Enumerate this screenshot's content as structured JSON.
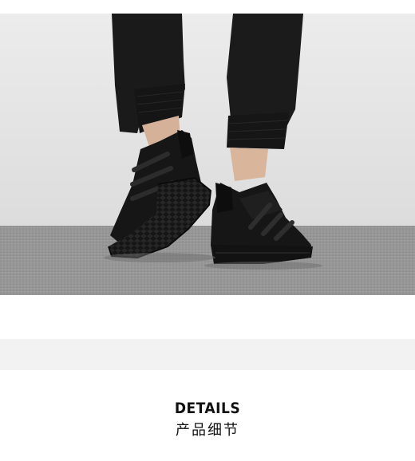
{
  "details_section": {
    "title": "DETAILS",
    "subtitle": "产品细节"
  },
  "photo": {
    "subject": "black-sneakers-on-feet",
    "colors": {
      "wall": "#e4e4e4",
      "floor": "#8f8f8f",
      "pants": "#1a1a1a",
      "shoe": "#161616",
      "skin": "#d9b59b"
    }
  }
}
